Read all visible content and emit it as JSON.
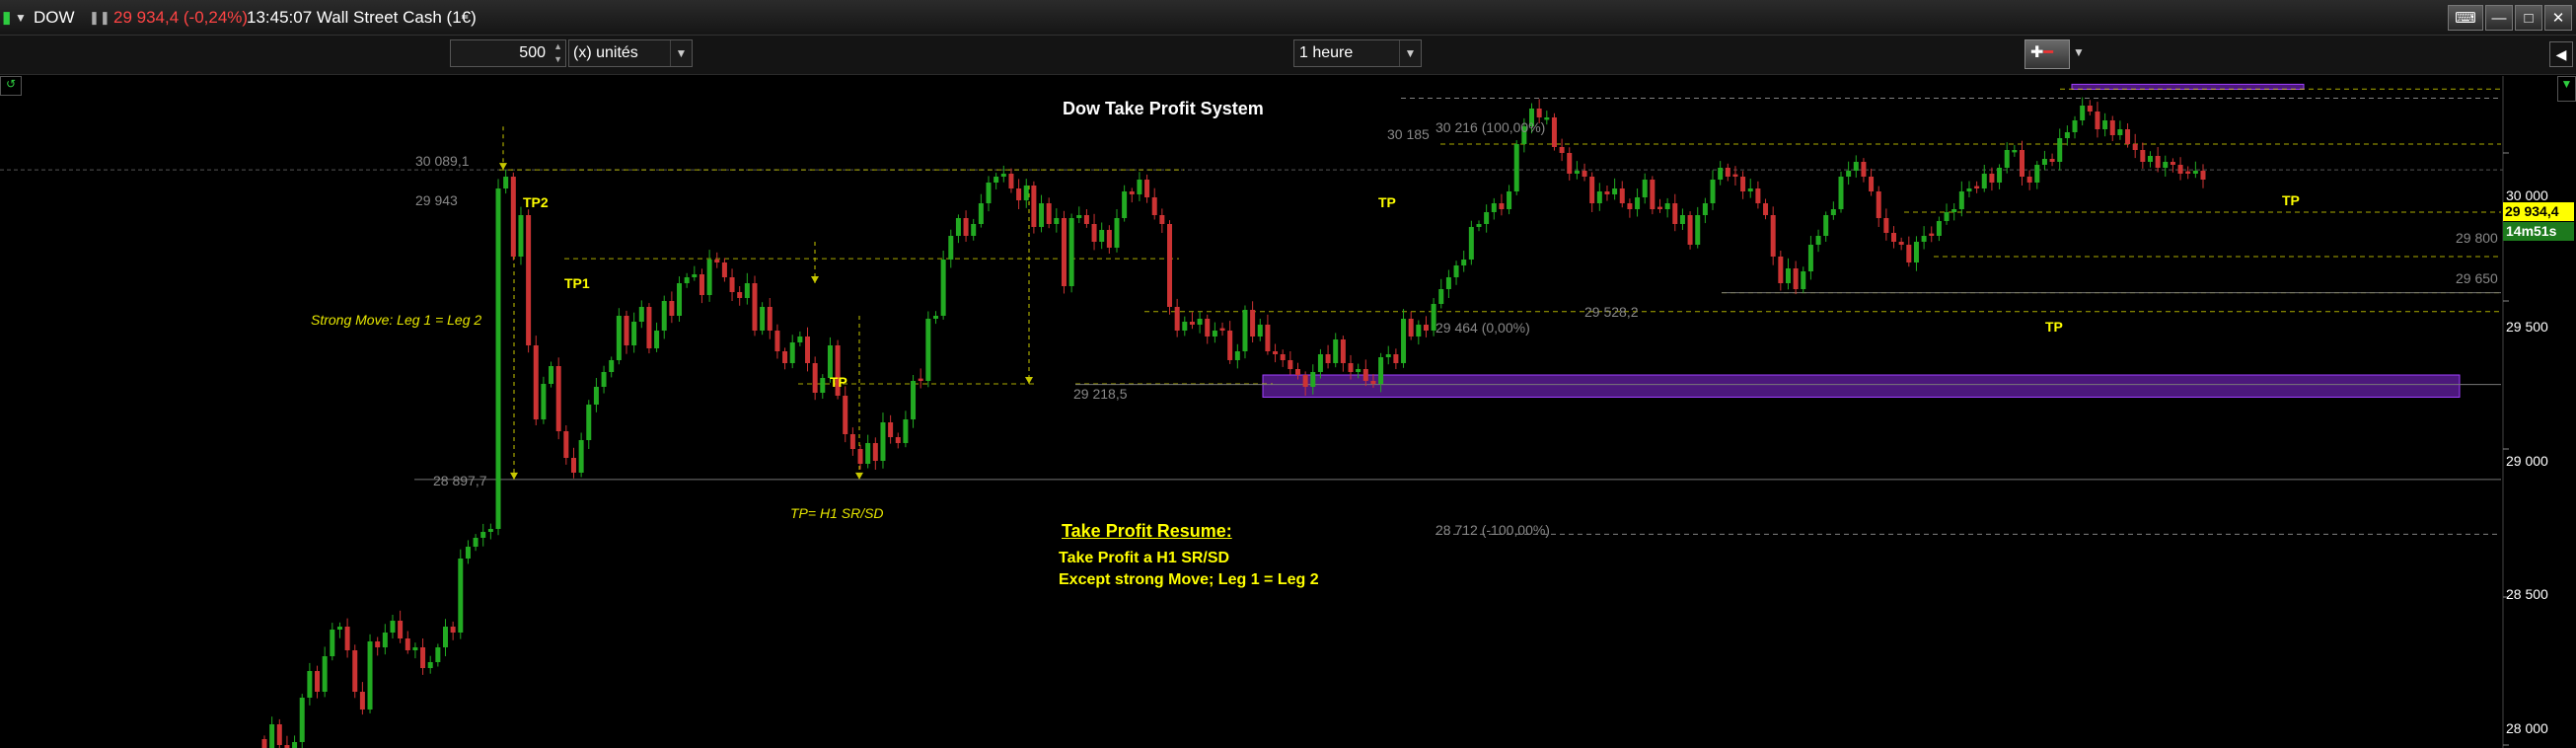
{
  "header": {
    "symbol": "DOW",
    "quote": "29 934,4 (-0,24%)",
    "time_instrument": "13:45:07 Wall Street Cash (1€)",
    "quote_color": "#ff4444"
  },
  "toolbar": {
    "quantity": "500",
    "units_label": "(x) unités",
    "timeframe": "1 heure"
  },
  "window_controls": [
    "keyboard-icon",
    "minimize-icon",
    "maximize-icon",
    "close-icon"
  ],
  "chart_data": {
    "type": "candlestick",
    "title": "Dow Take Profit System",
    "y_axis": {
      "ticks": [
        "30 000",
        "29 500",
        "29 000",
        "28 500",
        "28 000"
      ],
      "tick_values": [
        30000,
        29500,
        29000,
        28500,
        28000
      ],
      "ylim": [
        27990,
        30260
      ]
    },
    "price_label": "29 934,4",
    "countdown_label": "14m51s",
    "axis_level_labels": [
      {
        "text": "29 800",
        "value": 29800
      },
      {
        "text": "29 650",
        "value": 29650
      }
    ],
    "levels": [
      {
        "text": "30 089,1",
        "value": 30089
      },
      {
        "text": "29 943",
        "value": 29943
      },
      {
        "text": "28 897,7",
        "value": 28897
      },
      {
        "text": "29 218,5",
        "value": 29218
      },
      {
        "text": "30 185",
        "value": 30185
      },
      {
        "text": "30 216 (100,00%)",
        "value": 30216
      },
      {
        "text": "29 464 (0,00%)",
        "value": 29464
      },
      {
        "text": "29 528,2",
        "value": 29528
      },
      {
        "text": "28 712 (-100,00%)",
        "value": 28712
      }
    ],
    "tp_labels": [
      "TP2",
      "TP1",
      "TP",
      "TP",
      "TP",
      "TP"
    ],
    "annotations": {
      "strong_move": "Strong Move: Leg 1 = Leg 2",
      "tp_rule": "TP= H1 SR/SD",
      "resume_title": "Take Profit Resume:",
      "resume_line1": "Take Profit a H1 SR/SD",
      "resume_line2": "Except strong Move; Leg 1 = Leg 2"
    },
    "zones": [
      {
        "name": "supply-zone",
        "from": 30215,
        "to": 30232,
        "color": "#8a2be2"
      },
      {
        "name": "demand-zone",
        "from": 29175,
        "to": 29250,
        "color": "#8a2be2"
      }
    ],
    "colors": {
      "up": "#22aa22",
      "down": "#cc3333",
      "level": "#c8c800",
      "text_yellow": "#ffff00"
    },
    "closes": [
      27990,
      28070,
      28000,
      27930,
      28010,
      28160,
      28250,
      28180,
      28300,
      28390,
      28400,
      28320,
      28180,
      28120,
      28350,
      28330,
      28380,
      28420,
      28360,
      28320,
      28330,
      28260,
      28280,
      28330,
      28400,
      28380,
      28630,
      28670,
      28700,
      28720,
      28730,
      29880,
      29920,
      29650,
      29790,
      29350,
      29100,
      29220,
      29280,
      29060,
      28970,
      28920,
      29030,
      29150,
      29210,
      29260,
      29300,
      29450,
      29350,
      29430,
      29480,
      29340,
      29400,
      29500,
      29450,
      29560,
      29580,
      29590,
      29520,
      29640,
      29630,
      29580,
      29530,
      29510,
      29560,
      29400,
      29480,
      29400,
      29330,
      29290,
      29360,
      29380,
      29290,
      29190,
      29240,
      29350,
      29180,
      29050,
      29000,
      28950,
      29020,
      28960,
      29090,
      29040,
      29020,
      29100,
      29230,
      29230,
      29440,
      29450,
      29640,
      29720,
      29780,
      29720,
      29760,
      29830,
      29900,
      29920,
      29930,
      29880,
      29840,
      29890,
      29750,
      29830,
      29760,
      29780,
      29550,
      29780,
      29790,
      29760,
      29700,
      29740,
      29680,
      29780,
      29870,
      29860,
      29910,
      29850,
      29790,
      29760,
      29480,
      29400,
      29430,
      29420,
      29440,
      29380,
      29400,
      29400,
      29300,
      29330,
      29470,
      29380,
      29420,
      29330,
      29320,
      29300,
      29270,
      29250,
      29210,
      29260,
      29320,
      29290,
      29370,
      29290,
      29260,
      29270,
      29230,
      29220,
      29310,
      29320,
      29290,
      29440,
      29380,
      29420,
      29400,
      29490,
      29540,
      29580,
      29620,
      29640,
      29750,
      29760,
      29800,
      29830,
      29810,
      29870,
      30030,
      30090,
      30150,
      30120,
      30120,
      30020,
      30000,
      29930,
      29940,
      29920,
      29830,
      29870,
      29860,
      29880,
      29830,
      29810,
      29850,
      29910,
      29810,
      29810,
      29830,
      29760,
      29790,
      29690,
      29790,
      29830,
      29910,
      29950,
      29920,
      29920,
      29870,
      29880,
      29830,
      29790,
      29650,
      29560,
      29610,
      29540,
      29600,
      29690,
      29720,
      29790,
      29810,
      29920,
      29940,
      29970,
      29920,
      29870,
      29780,
      29730,
      29700,
      29690,
      29630,
      29700,
      29720,
      29720,
      29770,
      29800,
      29810,
      29870,
      29880,
      29880,
      29930,
      29900,
      29950,
      30010,
      30010,
      29920,
      29900,
      29960,
      29980,
      29970,
      30050,
      30070,
      30110,
      30160,
      30140,
      30080,
      30110,
      30060,
      30080,
      30030,
      30010,
      29970,
      29990,
      29950,
      29970,
      29960,
      29930,
      29930,
      29940,
      29910
    ]
  }
}
